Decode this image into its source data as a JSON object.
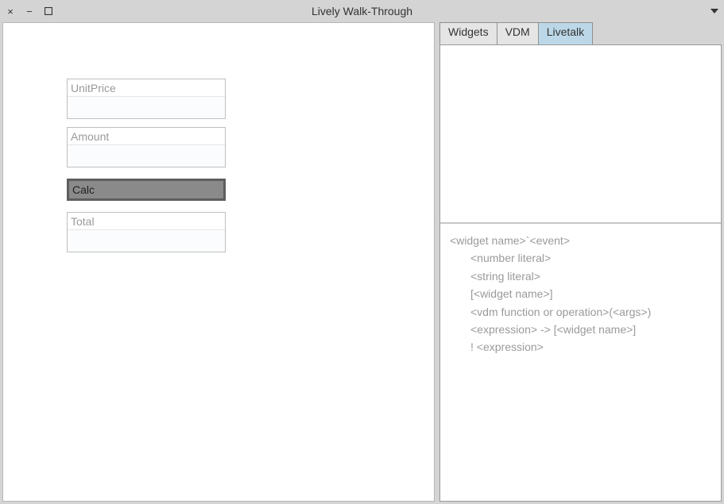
{
  "window": {
    "title": "Lively Walk-Through"
  },
  "form": {
    "unitprice": {
      "label": "UnitPrice",
      "value": ""
    },
    "amount": {
      "label": "Amount",
      "value": ""
    },
    "total": {
      "label": "Total",
      "value": ""
    },
    "calc_label": "Calc"
  },
  "tabs": {
    "widgets": "Widgets",
    "vdm": "VDM",
    "livetalk": "Livetalk",
    "active": "livetalk"
  },
  "help": {
    "line1": "<widget name>`<event>",
    "line2": "<number literal>",
    "line3": "<string literal>",
    "line4": "[<widget name>]",
    "line5": "<vdm function or operation>(<args>)",
    "line6": "<expression> -> [<widget name>]",
    "line7": "! <expression>"
  }
}
